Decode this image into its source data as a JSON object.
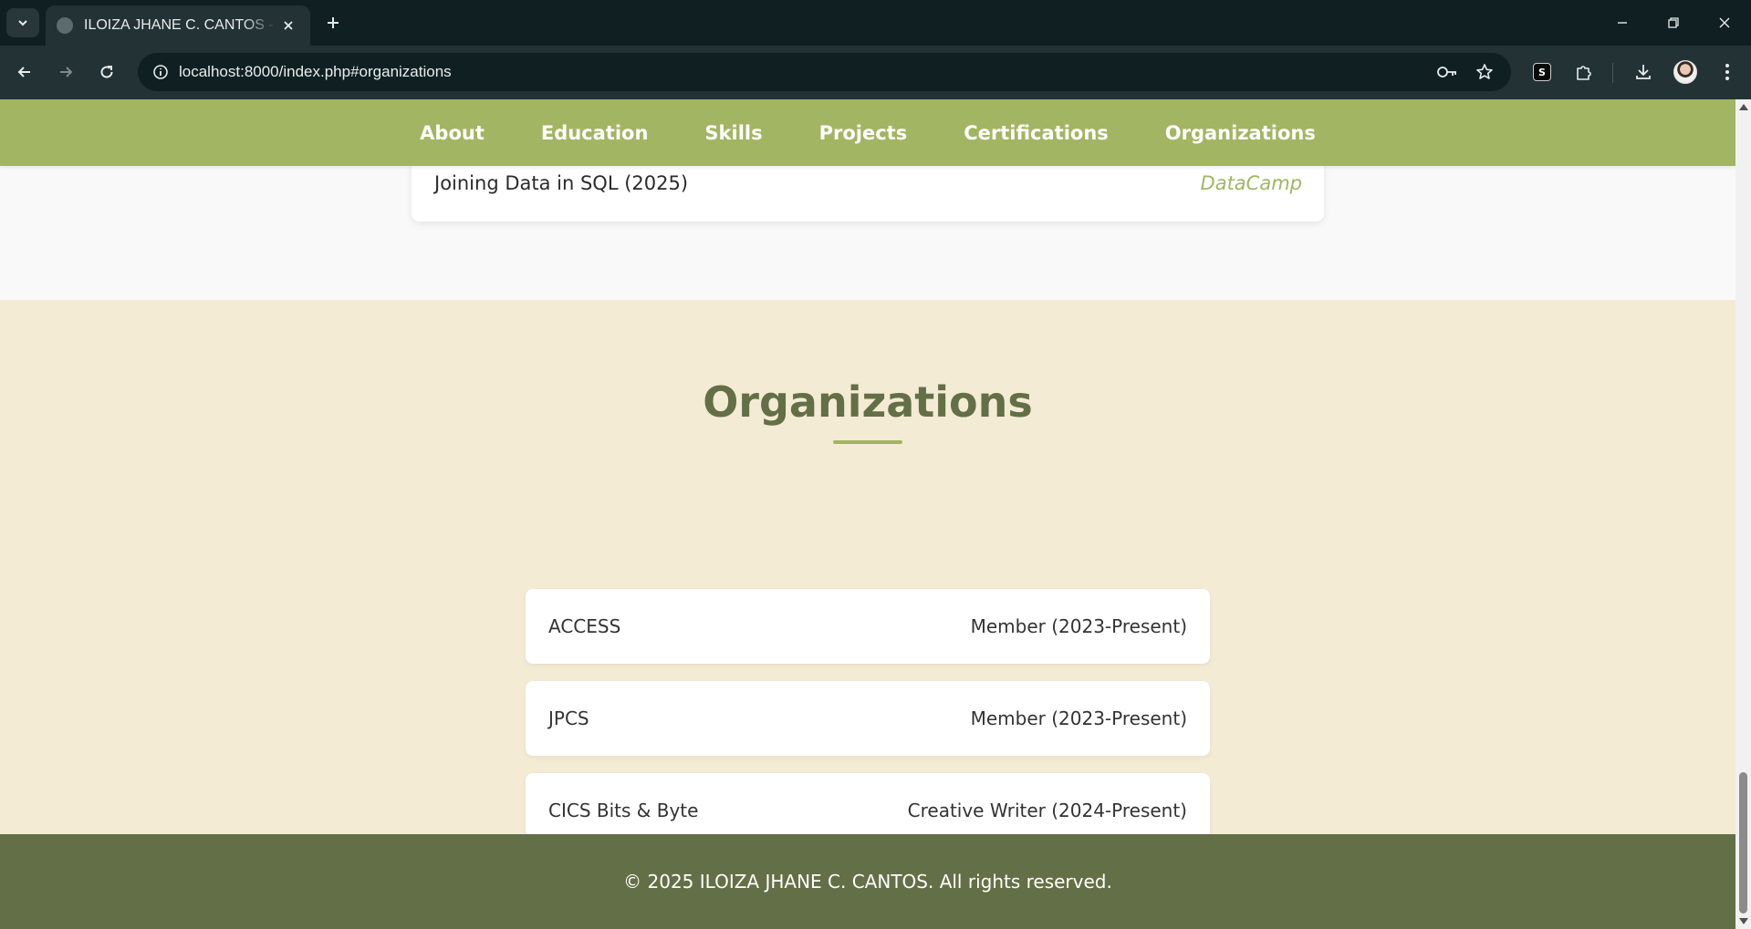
{
  "browser": {
    "tab_title": "ILOIZA JHANE C. CANTOS - Portfolio",
    "url": "localhost:8000/index.php#organizations",
    "extension_badge": "S"
  },
  "nav": {
    "items": [
      {
        "label": "About"
      },
      {
        "label": "Education"
      },
      {
        "label": "Skills"
      },
      {
        "label": "Projects"
      },
      {
        "label": "Certifications"
      },
      {
        "label": "Organizations"
      }
    ]
  },
  "certifications": {
    "last_item": {
      "name": "Joining Data in SQL (2025)",
      "issuer": "DataCamp"
    }
  },
  "organizations": {
    "title": "Organizations",
    "items": [
      {
        "name": "ACCESS",
        "role": "Member (2023-Present)"
      },
      {
        "name": "JPCS",
        "role": "Member (2023-Present)"
      },
      {
        "name": "CICS Bits & Byte",
        "role": "Creative Writer (2024-Present)"
      }
    ]
  },
  "footer": {
    "text": "© 2025 ILOIZA JHANE C. CANTOS. All rights reserved."
  },
  "colors": {
    "nav_bg": "#a2b563",
    "section_bg": "#f4ebd5",
    "title_color": "#636f46",
    "footer_bg": "#636f46"
  }
}
